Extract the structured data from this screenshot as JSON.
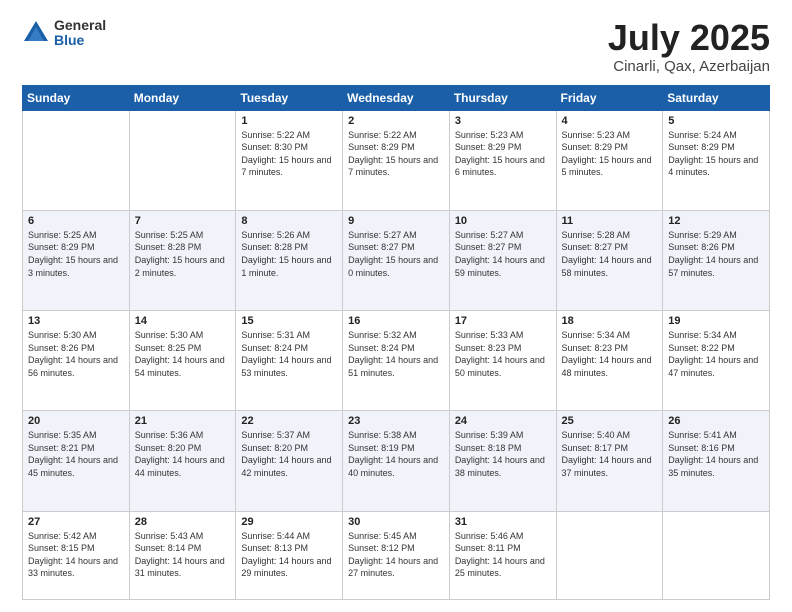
{
  "header": {
    "logo_general": "General",
    "logo_blue": "Blue",
    "title": "July 2025",
    "location": "Cinarli, Qax, Azerbaijan"
  },
  "weekdays": [
    "Sunday",
    "Monday",
    "Tuesday",
    "Wednesday",
    "Thursday",
    "Friday",
    "Saturday"
  ],
  "weeks": [
    [
      {
        "day": "",
        "info": ""
      },
      {
        "day": "",
        "info": ""
      },
      {
        "day": "1",
        "info": "Sunrise: 5:22 AM\nSunset: 8:30 PM\nDaylight: 15 hours and 7 minutes."
      },
      {
        "day": "2",
        "info": "Sunrise: 5:22 AM\nSunset: 8:29 PM\nDaylight: 15 hours and 7 minutes."
      },
      {
        "day": "3",
        "info": "Sunrise: 5:23 AM\nSunset: 8:29 PM\nDaylight: 15 hours and 6 minutes."
      },
      {
        "day": "4",
        "info": "Sunrise: 5:23 AM\nSunset: 8:29 PM\nDaylight: 15 hours and 5 minutes."
      },
      {
        "day": "5",
        "info": "Sunrise: 5:24 AM\nSunset: 8:29 PM\nDaylight: 15 hours and 4 minutes."
      }
    ],
    [
      {
        "day": "6",
        "info": "Sunrise: 5:25 AM\nSunset: 8:29 PM\nDaylight: 15 hours and 3 minutes."
      },
      {
        "day": "7",
        "info": "Sunrise: 5:25 AM\nSunset: 8:28 PM\nDaylight: 15 hours and 2 minutes."
      },
      {
        "day": "8",
        "info": "Sunrise: 5:26 AM\nSunset: 8:28 PM\nDaylight: 15 hours and 1 minute."
      },
      {
        "day": "9",
        "info": "Sunrise: 5:27 AM\nSunset: 8:27 PM\nDaylight: 15 hours and 0 minutes."
      },
      {
        "day": "10",
        "info": "Sunrise: 5:27 AM\nSunset: 8:27 PM\nDaylight: 14 hours and 59 minutes."
      },
      {
        "day": "11",
        "info": "Sunrise: 5:28 AM\nSunset: 8:27 PM\nDaylight: 14 hours and 58 minutes."
      },
      {
        "day": "12",
        "info": "Sunrise: 5:29 AM\nSunset: 8:26 PM\nDaylight: 14 hours and 57 minutes."
      }
    ],
    [
      {
        "day": "13",
        "info": "Sunrise: 5:30 AM\nSunset: 8:26 PM\nDaylight: 14 hours and 56 minutes."
      },
      {
        "day": "14",
        "info": "Sunrise: 5:30 AM\nSunset: 8:25 PM\nDaylight: 14 hours and 54 minutes."
      },
      {
        "day": "15",
        "info": "Sunrise: 5:31 AM\nSunset: 8:24 PM\nDaylight: 14 hours and 53 minutes."
      },
      {
        "day": "16",
        "info": "Sunrise: 5:32 AM\nSunset: 8:24 PM\nDaylight: 14 hours and 51 minutes."
      },
      {
        "day": "17",
        "info": "Sunrise: 5:33 AM\nSunset: 8:23 PM\nDaylight: 14 hours and 50 minutes."
      },
      {
        "day": "18",
        "info": "Sunrise: 5:34 AM\nSunset: 8:23 PM\nDaylight: 14 hours and 48 minutes."
      },
      {
        "day": "19",
        "info": "Sunrise: 5:34 AM\nSunset: 8:22 PM\nDaylight: 14 hours and 47 minutes."
      }
    ],
    [
      {
        "day": "20",
        "info": "Sunrise: 5:35 AM\nSunset: 8:21 PM\nDaylight: 14 hours and 45 minutes."
      },
      {
        "day": "21",
        "info": "Sunrise: 5:36 AM\nSunset: 8:20 PM\nDaylight: 14 hours and 44 minutes."
      },
      {
        "day": "22",
        "info": "Sunrise: 5:37 AM\nSunset: 8:20 PM\nDaylight: 14 hours and 42 minutes."
      },
      {
        "day": "23",
        "info": "Sunrise: 5:38 AM\nSunset: 8:19 PM\nDaylight: 14 hours and 40 minutes."
      },
      {
        "day": "24",
        "info": "Sunrise: 5:39 AM\nSunset: 8:18 PM\nDaylight: 14 hours and 38 minutes."
      },
      {
        "day": "25",
        "info": "Sunrise: 5:40 AM\nSunset: 8:17 PM\nDaylight: 14 hours and 37 minutes."
      },
      {
        "day": "26",
        "info": "Sunrise: 5:41 AM\nSunset: 8:16 PM\nDaylight: 14 hours and 35 minutes."
      }
    ],
    [
      {
        "day": "27",
        "info": "Sunrise: 5:42 AM\nSunset: 8:15 PM\nDaylight: 14 hours and 33 minutes."
      },
      {
        "day": "28",
        "info": "Sunrise: 5:43 AM\nSunset: 8:14 PM\nDaylight: 14 hours and 31 minutes."
      },
      {
        "day": "29",
        "info": "Sunrise: 5:44 AM\nSunset: 8:13 PM\nDaylight: 14 hours and 29 minutes."
      },
      {
        "day": "30",
        "info": "Sunrise: 5:45 AM\nSunset: 8:12 PM\nDaylight: 14 hours and 27 minutes."
      },
      {
        "day": "31",
        "info": "Sunrise: 5:46 AM\nSunset: 8:11 PM\nDaylight: 14 hours and 25 minutes."
      },
      {
        "day": "",
        "info": ""
      },
      {
        "day": "",
        "info": ""
      }
    ]
  ]
}
